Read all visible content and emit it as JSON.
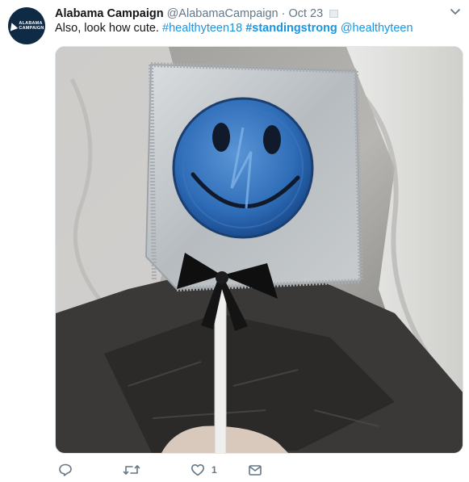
{
  "tweet": {
    "author_name": "Alabama Campaign",
    "author_handle": "@AlabamaCampaign",
    "separator": "·",
    "date": "Oct 23",
    "avatar_text_line1": "ALABAMA",
    "avatar_text_line2": "CAMPAIGN",
    "text_plain": "Also, look how cute. ",
    "hashtag1": "#healthyteen18",
    "hashtag2": "#standingstrong",
    "mention": "@healthyteen",
    "media_icon": "photo-condom-lollipop-smiley",
    "actions": {
      "reply_icon": "reply-icon",
      "retweet_icon": "retweet-icon",
      "like_icon": "heart-icon",
      "like_count": "1",
      "dm_icon": "envelope-icon"
    }
  },
  "colors": {
    "name": "#14171a",
    "secondary": "#657786",
    "link": "#1b95e0",
    "avatar_bg": "#0e2a44"
  }
}
